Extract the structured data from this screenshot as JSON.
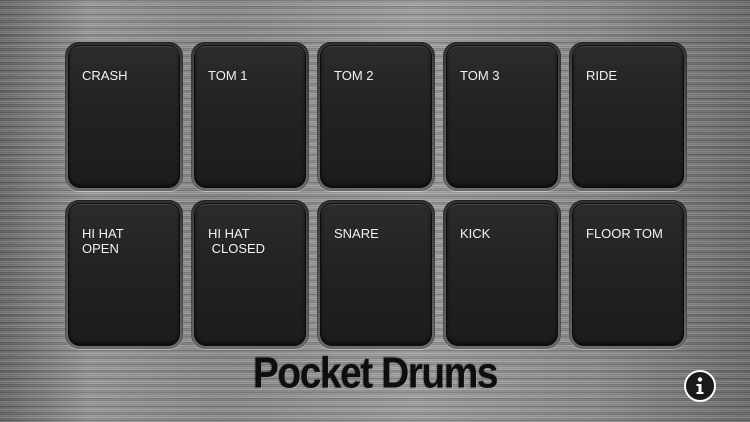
{
  "app": {
    "logo_text": "Pocket Drums"
  },
  "pads": [
    {
      "label": "CRASH"
    },
    {
      "label": "TOM 1"
    },
    {
      "label": "TOM 2"
    },
    {
      "label": "TOM 3"
    },
    {
      "label": "RIDE"
    },
    {
      "label": "HI HAT\nOPEN"
    },
    {
      "label": "HI HAT\n CLOSED"
    },
    {
      "label": "SNARE"
    },
    {
      "label": "KICK"
    },
    {
      "label": "FLOOR TOM"
    }
  ],
  "info_button": {
    "icon": "info-icon"
  },
  "colors": {
    "pad": "#232323",
    "pad_text": "#f2f2f2",
    "background": "#8c8c8c"
  }
}
